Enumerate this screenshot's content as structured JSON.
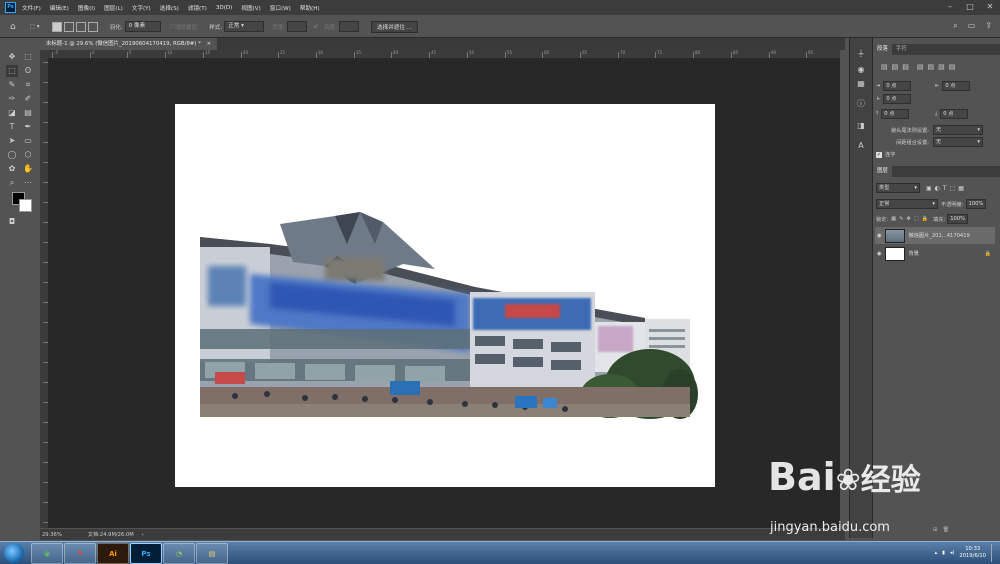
{
  "menubar": {
    "app_icon": "Ps",
    "items": [
      "文件(F)",
      "编辑(E)",
      "图像(I)",
      "图层(L)",
      "文字(Y)",
      "选择(S)",
      "滤镜(T)",
      "3D(D)",
      "视图(V)",
      "窗口(W)",
      "帮助(H)"
    ]
  },
  "options": {
    "feather_label": "羽化:",
    "feather_value": "0 像素",
    "antialias": "消除锯齿",
    "style_label": "样式:",
    "style_value": "正常",
    "width_label": "宽度:",
    "height_label": "高度:",
    "select_mask_button": "选择并遮住 ..."
  },
  "document": {
    "tab_title": "未标题-1 @ 29.6% (微信图片_20190604170419, RGB/8#) *",
    "close": "×"
  },
  "ruler": {
    "top_labels": [
      "-5",
      "0",
      "5",
      "10",
      "15",
      "20",
      "25",
      "30",
      "35",
      "40",
      "45",
      "50",
      "55",
      "60",
      "65",
      "70",
      "75",
      "80",
      "85",
      "90",
      "95"
    ]
  },
  "status": {
    "zoom": "29.36%",
    "doc_size": "文档:24.9M/26.0M"
  },
  "paragraph_panel": {
    "tabs": [
      "段落",
      "字符"
    ],
    "indent_left": "0 点",
    "indent_right": "0 点",
    "indent_first": "0 点",
    "space_before": "0 点",
    "space_after": "0 点",
    "kinsoku_label": "避头尾法则设置:",
    "kinsoku_value": "无",
    "mojikumi_label": "间距组合设置:",
    "mojikumi_value": "无",
    "hyphenate_label": "连字"
  },
  "layers_panel": {
    "tab": "图层",
    "filter_kind": "类型",
    "blend_mode": "正常",
    "opacity_label": "不透明度:",
    "opacity_value": "100%",
    "lock_label": "锁定:",
    "fill_label": "填充:",
    "fill_value": "100%",
    "layers": [
      {
        "name": "微信图片_201...4170419",
        "selected": true
      },
      {
        "name": "背景",
        "selected": false
      }
    ]
  },
  "taskbar": {
    "apps": [
      "chrome",
      "pdf",
      "Ai",
      "Ps",
      "green-app",
      "folder"
    ],
    "time": "10:33",
    "date": "2019/6/10"
  },
  "watermark": {
    "brand": "Bai",
    "brand_cn": "经验",
    "url": "jingyan.baidu.com"
  },
  "colors": {
    "ui_bg": "#535353",
    "workspace": "#282828",
    "accent": "#31a8ff"
  }
}
